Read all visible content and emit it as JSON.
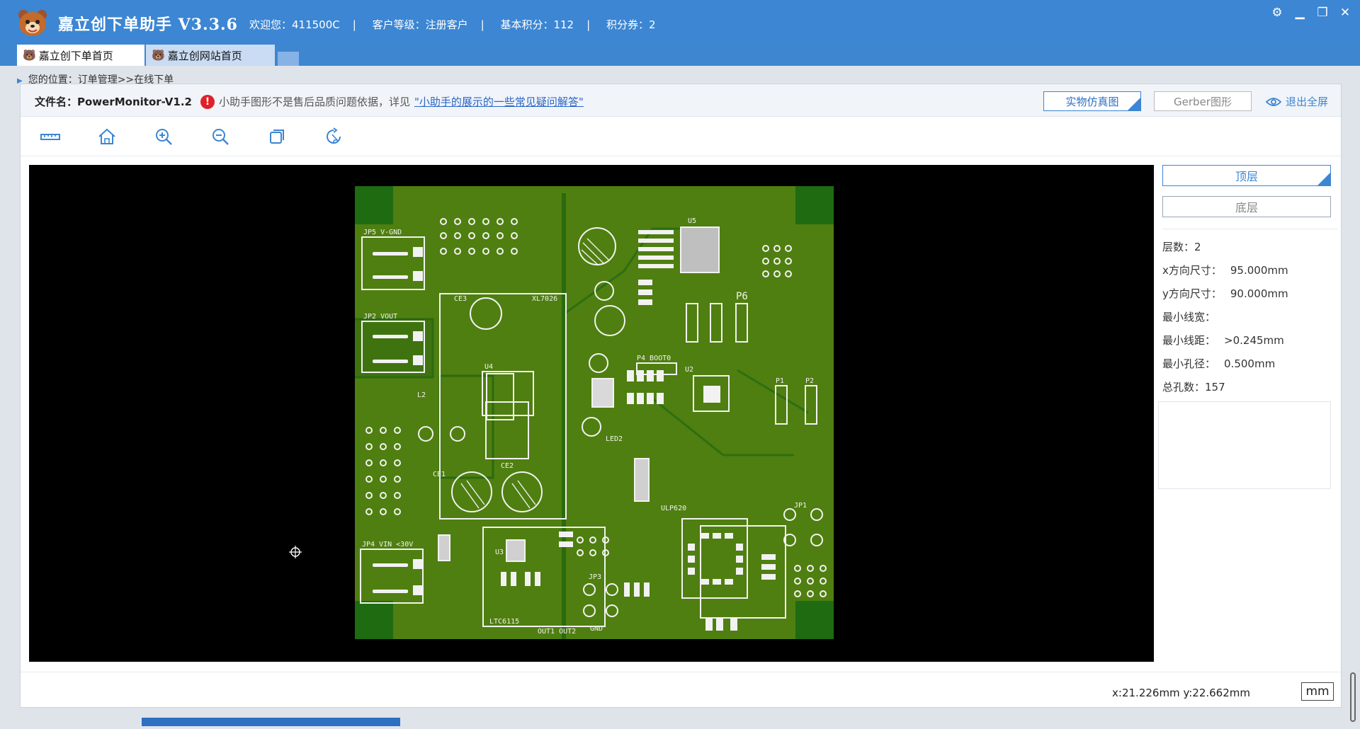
{
  "app": {
    "title": "嘉立创下单助手 V3.3.6",
    "welcome": "欢迎您：411500C",
    "level": "客户等级：注册客户",
    "points": "基本积分：112",
    "coupons": "积分券：2",
    "sep": "|"
  },
  "window_controls": {
    "settings": "⚙",
    "minimize": "▁",
    "restore": "❐",
    "close": "✕"
  },
  "tabs": [
    {
      "label": "嘉立创下单首页",
      "active": true
    },
    {
      "label": "嘉立创网站首页",
      "active": false
    }
  ],
  "breadcrumb": "您的位置：订单管理>>在线下单",
  "file_bar": {
    "file_label": "文件名：PowerMonitor-V1.2",
    "warning_prefix": "小助手图形不是售后品质问题依据，详见",
    "warning_link": "\"小助手的展示的一些常见疑问解答\"",
    "sim_button": "实物仿真图",
    "gerber_button": "Gerber图形",
    "exit_fullscreen": "退出全屏"
  },
  "toolbar": {
    "tools": [
      "measure-icon",
      "home-icon",
      "zoom-in-icon",
      "zoom-out-icon",
      "copy-icon",
      "rotate-icon"
    ]
  },
  "side_panel": {
    "top_layer": "顶层",
    "bottom_layer": "底层",
    "props": [
      {
        "label": "层数：",
        "value": "2"
      },
      {
        "label": "x方向尺寸：",
        "value": "95.000mm"
      },
      {
        "label": "y方向尺寸：",
        "value": "90.000mm"
      },
      {
        "label": "最小线宽：",
        "value": ""
      },
      {
        "label": "最小线距：",
        "value": ">0.245mm"
      },
      {
        "label": "最小孔径：",
        "value": "0.500mm"
      },
      {
        "label": "总孔数：",
        "value": "157"
      }
    ]
  },
  "footer": {
    "coords": "x:21.226mm  y:22.662mm",
    "unit": "mm"
  },
  "pcb_labels": {
    "jp5": "JP5  V-GND",
    "jp2": "JP2  VOUT",
    "jp4": "JP4  VIN  <30V",
    "u5": "U5",
    "u4": "U4",
    "u2": "U2",
    "u3": "U3",
    "l2": "L2",
    "ce1": "CE1",
    "ce2": "CE2",
    "ce3": "CE3",
    "xl": "XL7026",
    "p6": "P6",
    "p4": "P4 BOOT0",
    "p1": "P1",
    "p2": "P2",
    "ltc": "LTC6115",
    "out": "OUT1  OUT2",
    "led2": "LED2",
    "gnd": "GND",
    "ulp": "ULP620",
    "jp3": "JP3",
    "jp1": "JP1"
  },
  "colors": {
    "accent": "#3c86d3",
    "pcb_green": "#4f7f10",
    "pcb_dark": "#1e6b12",
    "silk": "#f2f2f2"
  }
}
